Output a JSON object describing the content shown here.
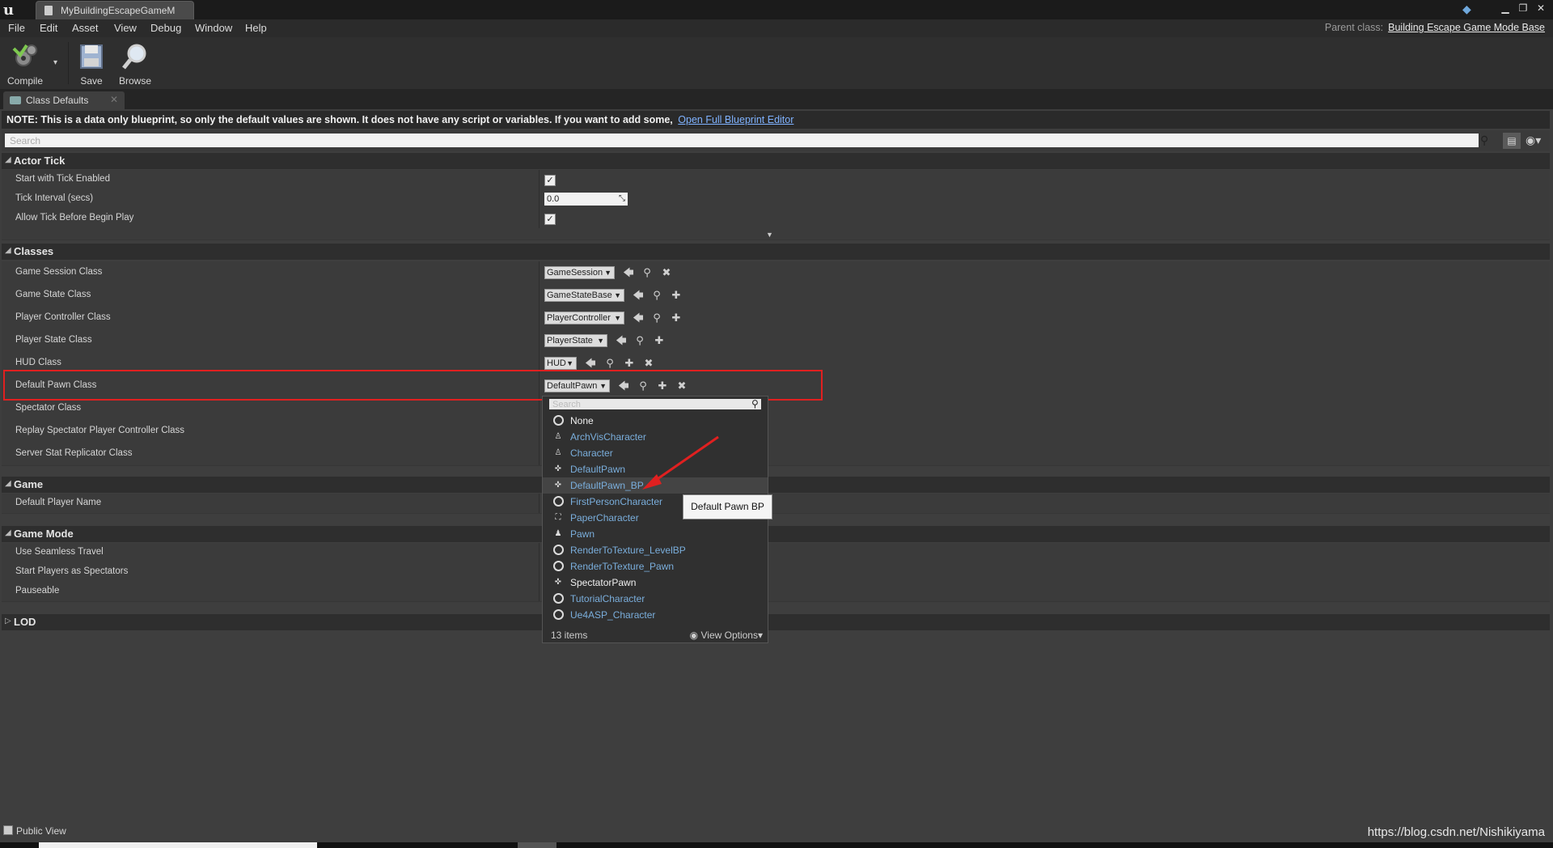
{
  "window": {
    "tab_title": "MyBuildingEscapeGameM",
    "logo_text": "u"
  },
  "menu": {
    "items": [
      "File",
      "Edit",
      "Asset",
      "View",
      "Debug",
      "Window",
      "Help"
    ],
    "parent_class_label": "Parent class:",
    "parent_class_value": "Building Escape Game Mode Base"
  },
  "toolbar": {
    "compile": "Compile",
    "save": "Save",
    "browse": "Browse"
  },
  "panel_tab": "Class Defaults",
  "note": {
    "text": "NOTE: This is a data only blueprint, so only the default values are shown.  It does not have any script or variables.  If you want to add some,",
    "link": "Open Full Blueprint Editor"
  },
  "search": {
    "placeholder": "Search"
  },
  "categories": {
    "actor_tick": {
      "title": "Actor Tick",
      "rows": {
        "start_with_tick": "Start with Tick Enabled",
        "tick_interval": "Tick Interval (secs)",
        "tick_interval_value": "0.0",
        "allow_tick": "Allow Tick Before Begin Play"
      }
    },
    "classes": {
      "title": "Classes",
      "rows": {
        "game_session": {
          "label": "Game Session Class",
          "value": "GameSession"
        },
        "game_state": {
          "label": "Game State Class",
          "value": "GameStateBase"
        },
        "player_controller": {
          "label": "Player Controller Class",
          "value": "PlayerController"
        },
        "player_state": {
          "label": "Player State Class",
          "value": "PlayerState"
        },
        "hud": {
          "label": "HUD Class",
          "value": "HUD"
        },
        "default_pawn": {
          "label": "Default Pawn Class",
          "value": "DefaultPawn"
        },
        "spectator": {
          "label": "Spectator Class"
        },
        "replay_spectator": {
          "label": "Replay Spectator Player Controller Class"
        },
        "server_stat": {
          "label": "Server Stat Replicator Class"
        }
      }
    },
    "game": {
      "title": "Game",
      "rows": {
        "default_player_name": "Default Player Name"
      }
    },
    "game_mode": {
      "title": "Game Mode",
      "rows": {
        "seamless": "Use Seamless Travel",
        "start_spectators": "Start Players as Spectators",
        "pauseable": "Pauseable"
      }
    },
    "lod": {
      "title": "LOD"
    }
  },
  "popup": {
    "search_placeholder": "Search",
    "options": [
      {
        "label": "None",
        "icon": "ring-icon",
        "plain": true
      },
      {
        "label": "ArchVisCharacter",
        "icon": "character-icon"
      },
      {
        "label": "Character",
        "icon": "character-icon"
      },
      {
        "label": "DefaultPawn",
        "icon": "pawn-icon"
      },
      {
        "label": "DefaultPawn_BP",
        "icon": "pawn-icon"
      },
      {
        "label": "FirstPersonCharacter",
        "icon": "ring-icon"
      },
      {
        "label": "PaperCharacter",
        "icon": "paper-icon"
      },
      {
        "label": "Pawn",
        "icon": "pawn-small-icon"
      },
      {
        "label": "RenderToTexture_LevelBP",
        "icon": "ring-icon"
      },
      {
        "label": "RenderToTexture_Pawn",
        "icon": "ring-icon"
      },
      {
        "label": "SpectatorPawn",
        "icon": "pawn-icon",
        "plain": true
      },
      {
        "label": "TutorialCharacter",
        "icon": "ring-icon"
      },
      {
        "label": "Ue4ASP_Character",
        "icon": "ring-icon"
      }
    ],
    "count": "13 items",
    "view_options": "View Options"
  },
  "tooltip": "Default Pawn BP",
  "footer": {
    "public_view": "Public View",
    "watermark": "https://blog.csdn.net/Nishikiyama"
  },
  "colors": {
    "highlight": "#e02020",
    "link": "#7aaedc"
  }
}
